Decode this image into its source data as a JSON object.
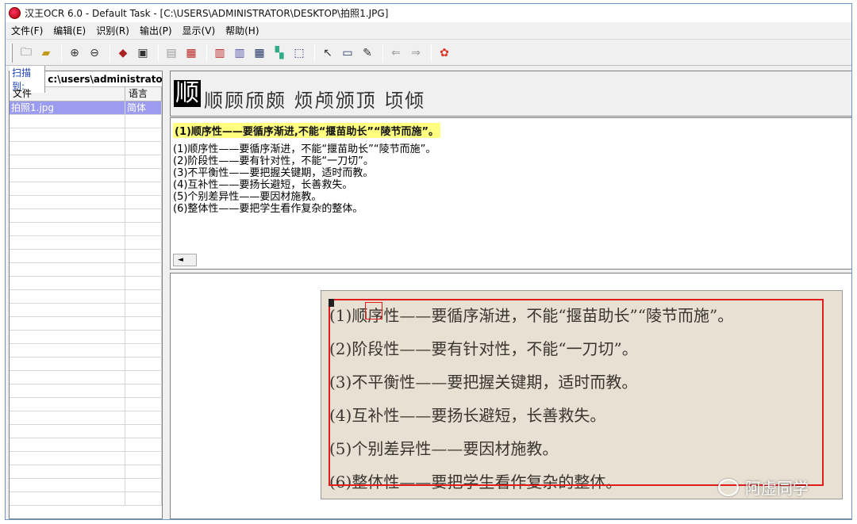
{
  "window": {
    "title": "汉王OCR 6.0 - Default Task - [C:\\USERS\\ADMINISTRATOR\\DESKTOP\\拍照1.JPG]"
  },
  "menu": [
    "文件(F)",
    "编辑(E)",
    "识别(R)",
    "输出(P)",
    "显示(V)",
    "帮助(H)"
  ],
  "toolbar_icons": [
    "open-icon",
    "folder-icon",
    "zoom-in-icon",
    "zoom-out-icon",
    "scan-icon",
    "image-icon",
    "page-icon",
    "recognize-icon",
    "layout-icon",
    "columns-icon",
    "table-icon",
    "chart-icon",
    "select-icon",
    "pointer-icon",
    "region-icon",
    "pen-icon",
    "back-arrow-icon",
    "forward-arrow-icon",
    "color-icon"
  ],
  "left_panel": {
    "scan_label": "扫描到:",
    "scan_path": "c:\\users\\administrator",
    "col_file": "文件",
    "col_lang": "语言",
    "files": [
      {
        "name": "拍照1.jpg",
        "lang": "简体"
      }
    ]
  },
  "char_bar": {
    "current": "顺",
    "candidates": "顺顾颀颇 烦颅颁顶 顷倾"
  },
  "result": {
    "highlight": "(1)顺序性——要循序渐进,不能“揠苗助长”“陵节而施”。",
    "lines": [
      "(1)顺序性——要循序渐进，不能“揠苗助长”“陵节而施”。",
      "(2)阶段性——要有针对性，不能“一刀切”。",
      "(3)不平衡性——要把握关键期，适时而教。",
      "(4)互补性——要扬长避短，长善救失。",
      "(5)个别差异性——要因材施教。",
      "(6)整体性——要把学生看作复杂的整体。"
    ]
  },
  "image_lines": [
    "(1)顺序性——要循序渐进，不能“揠苗助长”“陵节而施”。",
    "(2)阶段性——要有针对性，不能“一刀切”。",
    "(3)不平衡性——要把握关键期，适时而教。",
    "(4)互补性——要扬长避短，长善救失。",
    "(5)个别差异性——要因材施教。",
    "(6)整体性——要把学生看作复杂的整体。"
  ],
  "watermark": "阿虚同学"
}
